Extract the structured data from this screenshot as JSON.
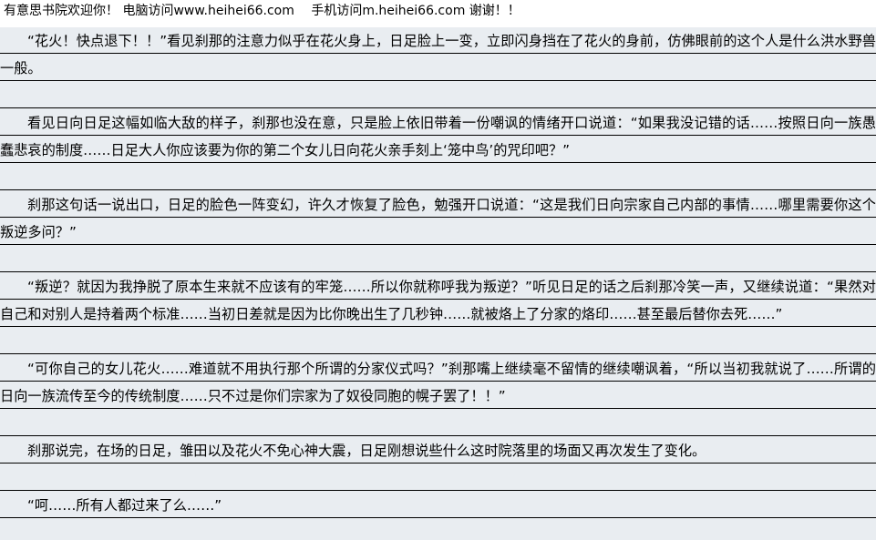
{
  "header": {
    "notice": "有意思书院欢迎你！ 电脑访问www.heihei66.com　 手机访问m.heihei66.com 谢谢！！"
  },
  "paragraphs": [
    "“花火！快点退下！！”看见刹那的注意力似乎在花火身上，日足脸上一变，立即闪身挡在了花火的身前，仿佛眼前的这个人是什么洪水野兽一般。",
    "看见日向日足这幅如临大敌的样子，刹那也没在意，只是脸上依旧带着一份嘲讽的情绪开口说道：“如果我没记错的话……按照日向一族愚蠢悲哀的制度……日足大人你应该要为你的第二个女儿日向花火亲手刻上‘笼中鸟’的咒印吧？”",
    "刹那这句话一说出口，日足的脸色一阵变幻，许久才恢复了脸色，勉强开口说道：“这是我们日向宗家自己内部的事情……哪里需要你这个叛逆多问？”",
    "“叛逆？就因为我挣脱了原本生来就不应该有的牢笼……所以你就称呼我为叛逆？”听见日足的话之后刹那冷笑一声，又继续说道：“果然对自己和对别人是持着两个标准……当初日差就是因为比你晚出生了几秒钟……就被烙上了分家的烙印……甚至最后替你去死……”",
    "“可你自己的女儿花火……难道就不用执行那个所谓的分家仪式吗？”刹那嘴上继续毫不留情的继续嘲讽着，“所以当初我就说了……所谓的日向一族流传至今的传统制度……只不过是你们宗家为了奴役同胞的幌子罢了！！”",
    "刹那说完，在场的日足，雏田以及花火不免心神大震，日足刚想说些什么这时院落里的场面又再次发生了变化。",
    "“呵……所有人都过来了么……”"
  ]
}
